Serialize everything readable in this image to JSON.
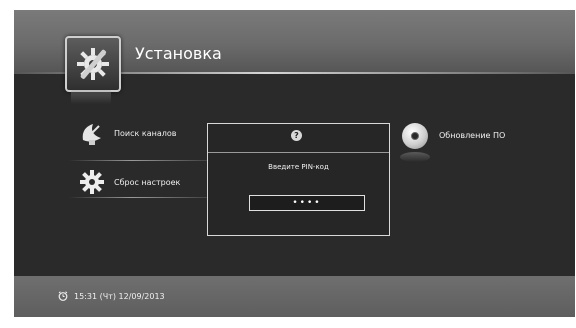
{
  "header": {
    "title": "Установка",
    "icon": "settings-wrench-gear-icon"
  },
  "menu": {
    "items": [
      {
        "label": "Поиск каналов",
        "icon": "satellite-dish-icon"
      },
      {
        "label": "Сброс настроек",
        "icon": "gear-icon"
      }
    ],
    "update": {
      "label": "Обновление ПО",
      "icon": "disc-icon"
    }
  },
  "dialog": {
    "help_icon": "?",
    "prompt": "Введите PIN-код",
    "pin_value": "••••"
  },
  "footer": {
    "clock": "15:31 (Чт) 12/09/2013",
    "icon": "alarm-clock-icon"
  },
  "colors": {
    "background": "#2a2a2a",
    "header": "#6b6b6b",
    "text": "#ffffff"
  }
}
